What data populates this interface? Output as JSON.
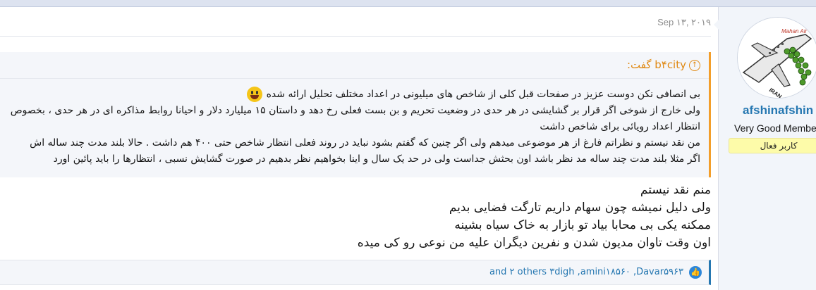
{
  "post": {
    "date": "Sep ۱۳, ۲۰۱۹",
    "quote": {
      "author_label": "b۴city گفت:",
      "lines": [
        "بی انصافی نکن دوست عزیز در صفحات قبل کلی از شاخص های میلیونی در اعداد مختلف تحلیل ارائه شده",
        "ولی خارج از شوخی اگر قرار بر گشایشی در هر حدی در وضعیت تحریم و بن بست فعلی رخ دهد و داستان ۱۵ میلیارد دلار و احیانا روابط مذاکره ای در هر حدی ، بخصوص",
        "انتظار اعداد رویائی برای شاخص داشت",
        "من نقد نیستم و نظراتم فارغ از هر موضوعی میدهم ولی اگر چنین که گفتم بشود نباید در روند فعلی انتظار شاخص حتی ۴۰۰ هم داشت . حالا بلند مدت چند ساله اش",
        "اگر مثلا بلند مدت چند ساله مد نظر باشد اون بحثش جداست ولی در حد یک سال و اینا بخواهیم نظر بدهیم در صورت گشایش نسبی ، انتظارها را باید پائین اورد"
      ]
    },
    "message_lines": [
      "منم نقد نیستم",
      "ولی دلیل نمیشه چون سهام داریم تارگت فضایی بدیم",
      "ممکنه یکی بی محابا بیاد تو بازار به خاک سیاه بشینه",
      "اون وقت تاوان مدیون شدن و نفرین دیگران علیه من نوعی رو کی میده"
    ],
    "reactions_text": "and ۲ others ۳digh ,amini۱۸۵۶۰ ,Davar۵۹۶۳",
    "reaction_icon": "like-icon"
  },
  "user": {
    "name": "afshinafshin",
    "title": "Very Good Member",
    "banner": "کاربر فعال",
    "avatar_text": "Mahan Air"
  },
  "colors": {
    "accent": "#2577b1",
    "quote_border": "#f39e2a",
    "banner_bg": "#fdfba9"
  }
}
